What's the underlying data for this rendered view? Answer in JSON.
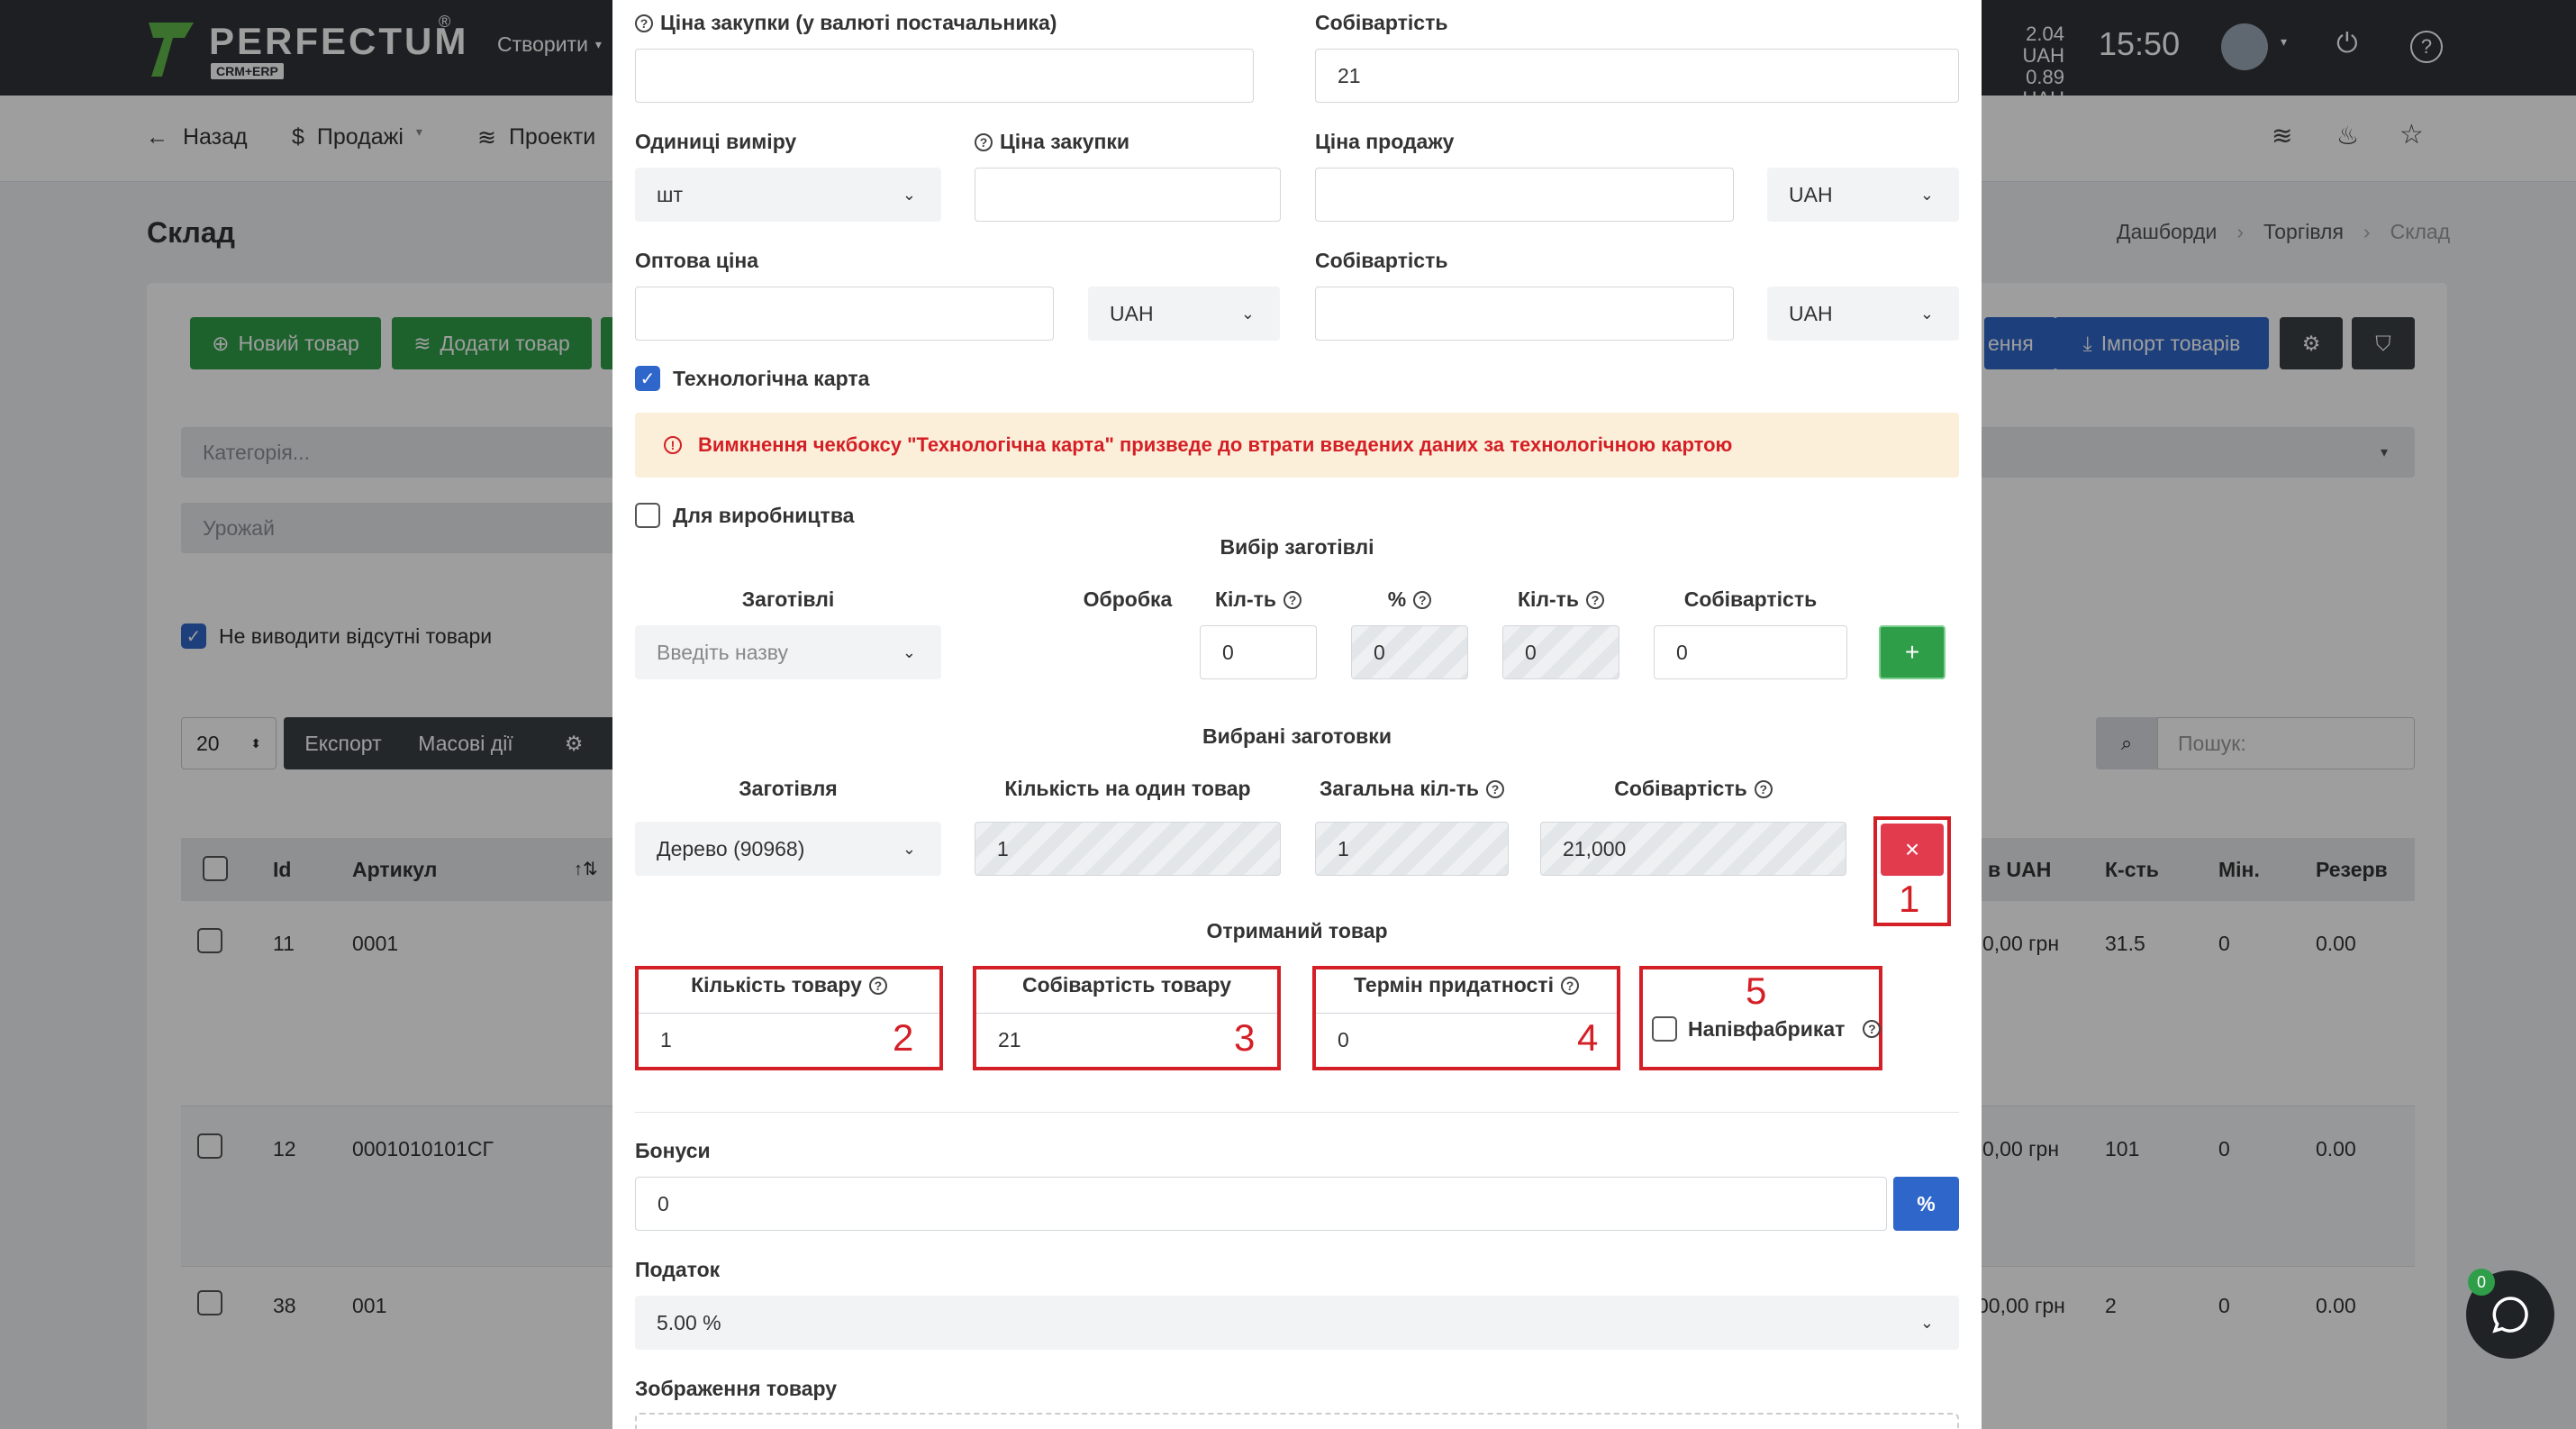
{
  "topbar": {
    "logo_text": "PERFECTUM",
    "logo_reg": "®",
    "logo_sub": "CRM+ERP",
    "create_label": "Створити",
    "rate1": "2.04 UAH",
    "rate2": "0.89 UAH",
    "time": "15:50"
  },
  "subnav": {
    "back": "Назад",
    "sales": "Продажі",
    "projects": "Проекти"
  },
  "page": {
    "title": "Склад",
    "breadcrumb": [
      "Дашборди",
      "Торгівля",
      "Склад"
    ],
    "new_item": "Новий товар",
    "add_item": "Додати товар",
    "btn_partial": "ення",
    "import": "Імпорт товарів",
    "category_placeholder": "Категорія...",
    "harvest": "Урожай",
    "hide_missing": "Не виводити відсутні товари",
    "page_size": "20",
    "export": "Експорт",
    "bulk": "Масові дії",
    "search_placeholder": "Пошук:",
    "columns": [
      "Id",
      "Артикул",
      "в UAH",
      "К-сть",
      "Мін.",
      "Резерв"
    ],
    "rows": [
      {
        "id": "11",
        "sku": "0001",
        "price": "0,00 грн",
        "qty": "31.5",
        "min": "0",
        "reserve": "0.00"
      },
      {
        "id": "12",
        "sku": "0001010101СГ",
        "price": "0,00 грн",
        "qty": "101",
        "min": "0",
        "reserve": "0.00"
      },
      {
        "id": "38",
        "sku": "001",
        "price": "00,00 грн",
        "qty": "2",
        "min": "0",
        "reserve": "0.00"
      }
    ],
    "chat_badge": "0"
  },
  "modal": {
    "purchase_price_supplier_label": "Ціна закупки (у валюті постачальника)",
    "cost_label_top": "Собівартість",
    "cost_value_top": "21",
    "units_label": "Одиниці виміру",
    "units_value": "шт",
    "purchase_price_label": "Ціна закупки",
    "sale_price_label": "Ціна продажу",
    "currency_sale": "UAH",
    "wholesale_label": "Оптова ціна",
    "currency_wholesale": "UAH",
    "cost_label_2": "Собівартість",
    "currency_cost": "UAH",
    "tech_card_label": "Технологічна карта",
    "warning_text": "Вимкнення чекбоксу \"Технологічна карта\" призведе до втрати введених даних за технологічною картою",
    "for_production_label": "Для виробництва",
    "blank_choice_title": "Вибір заготівлі",
    "blanks_col": {
      "blanks": "Заготівлі",
      "processing": "Обробка",
      "qty": "Кіл-ть",
      "pct": "%",
      "qty2": "Кіл-ть",
      "cost": "Собівартість"
    },
    "blank_placeholder": "Введіть назву",
    "blank_qty": "0",
    "blank_pct": "0",
    "blank_qty2": "0",
    "blank_cost": "0",
    "add_btn": "+",
    "selected_title": "Вибрані заготовки",
    "selected_col": {
      "blank": "Заготівля",
      "per_item": "Кількість на один товар",
      "total": "Загальна кіл-ть",
      "cost": "Собівартість"
    },
    "selected_blank": "Дерево (90968)",
    "selected_per_item": "1",
    "selected_total": "1",
    "selected_cost": "21,000",
    "remove_btn": "×",
    "received_title": "Отриманий товар",
    "qty_product_label": "Кількість товару",
    "qty_product_value": "1",
    "cost_product_label": "Собівартість товару",
    "cost_product_value": "21",
    "shelf_life_label": "Термін придатності",
    "shelf_life_value": "0",
    "semi_label": "Напівфабрикат",
    "bonus_label": "Бонуси",
    "bonus_value": "0",
    "bonus_unit": "%",
    "tax_label": "Податок",
    "tax_value": "5.00 %",
    "image_label": "Зображення товару",
    "markers": [
      "1",
      "2",
      "3",
      "4",
      "5"
    ]
  }
}
